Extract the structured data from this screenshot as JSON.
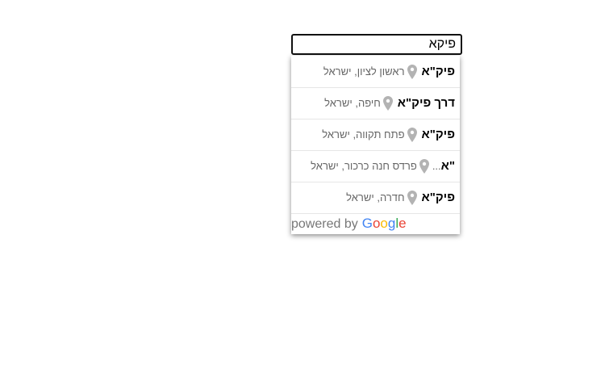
{
  "search": {
    "value": "פיקא",
    "placeholder": ""
  },
  "suggestions": [
    {
      "main": "פיק\"א",
      "secondary": "ראשון לציון, ישראל",
      "icon": "map-pin-icon"
    },
    {
      "main": "דרך פיק\"א",
      "secondary": "חיפה, ישראל",
      "icon": "map-pin-icon"
    },
    {
      "main": "פיק\"א",
      "secondary": "פתח תקווה, ישראל",
      "icon": "map-pin-icon"
    },
    {
      "main": "\"א",
      "ellipsis": "...",
      "secondary": "פרדס חנה כרכור, ישראל",
      "icon": "map-pin-icon"
    },
    {
      "main": "פיק\"א",
      "secondary": "חדרה, ישראל",
      "icon": "map-pin-icon"
    }
  ],
  "attribution": {
    "prefix": "powered by",
    "brand": "Google",
    "brand_colors": [
      "#4285F4",
      "#EA4335",
      "#FBBC05",
      "#4285F4",
      "#34A853",
      "#EA4335"
    ]
  },
  "colors": {
    "pin": "#b3b3b3",
    "secondary_text": "#666666"
  }
}
